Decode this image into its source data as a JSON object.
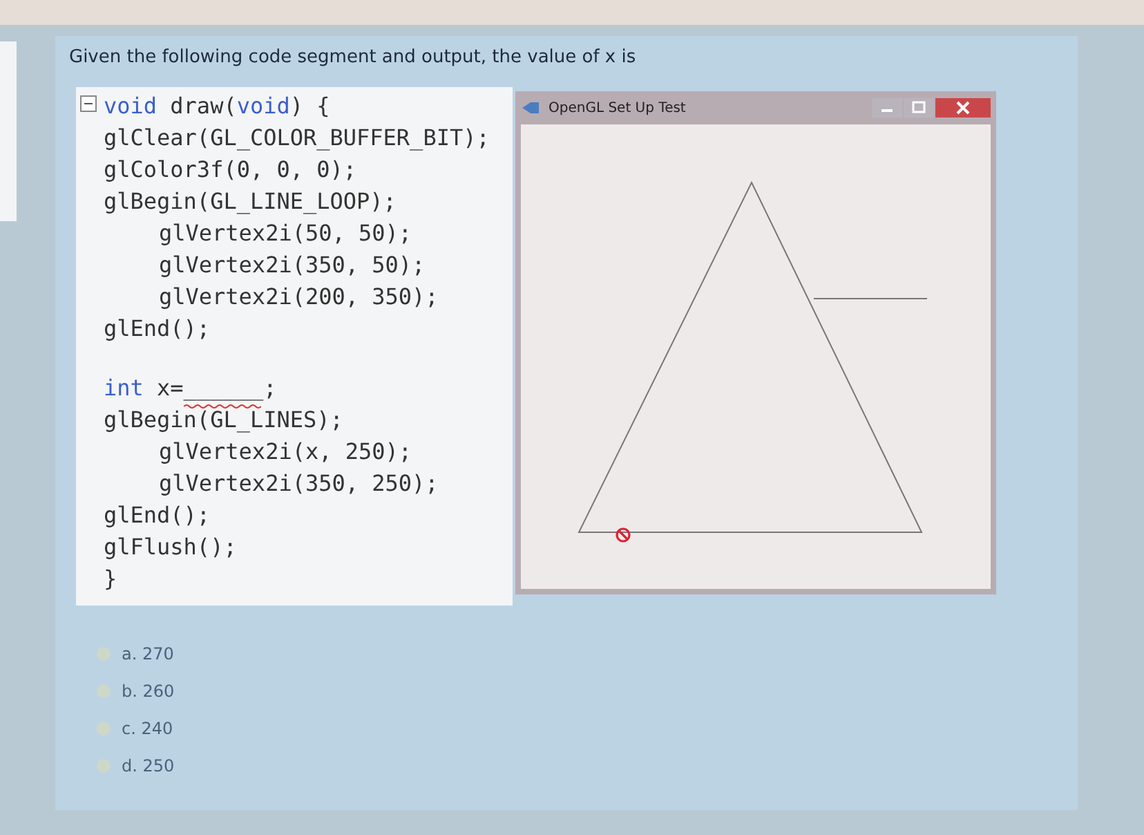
{
  "question": {
    "text": "Given the following code segment and output, the value of x is"
  },
  "code": {
    "blocks": [
      [
        {
          "segments": [
            {
              "kind": "keyword",
              "text": "void"
            },
            {
              "kind": "plain",
              "text": " draw("
            },
            {
              "kind": "keyword",
              "text": "void"
            },
            {
              "kind": "plain",
              "text": ") {"
            }
          ]
        },
        {
          "segments": [
            {
              "kind": "plain",
              "text": "glClear(GL_COLOR_BUFFER_BIT);"
            }
          ]
        },
        {
          "segments": [
            {
              "kind": "plain",
              "text": "glColor3f(0, 0, 0);"
            }
          ]
        },
        {
          "segments": [
            {
              "kind": "plain",
              "text": "glBegin(GL_LINE_LOOP);"
            }
          ],
          "children": [
            {
              "segments": [
                {
                  "kind": "plain",
                  "text": "glVertex2i(50, 50);"
                }
              ]
            },
            {
              "segments": [
                {
                  "kind": "plain",
                  "text": "glVertex2i(350, 50);"
                }
              ]
            },
            {
              "segments": [
                {
                  "kind": "plain",
                  "text": "glVertex2i(200, 350);"
                }
              ]
            }
          ]
        },
        {
          "segments": [
            {
              "kind": "plain",
              "text": "glEnd();"
            }
          ]
        }
      ],
      [
        {
          "segments": [
            {
              "kind": "keyword",
              "text": "int"
            },
            {
              "kind": "plain",
              "text": " x=______;"
            }
          ],
          "error_marked": true
        },
        {
          "segments": [
            {
              "kind": "plain",
              "text": "glBegin(GL_LINES);"
            }
          ],
          "children": [
            {
              "segments": [
                {
                  "kind": "plain",
                  "text": "glVertex2i(x, 250);"
                }
              ]
            },
            {
              "segments": [
                {
                  "kind": "plain",
                  "text": "glVertex2i(350, 250);"
                }
              ]
            }
          ]
        },
        {
          "segments": [
            {
              "kind": "plain",
              "text": "glEnd();"
            }
          ]
        },
        {
          "segments": [
            {
              "kind": "plain",
              "text": "glFlush();"
            }
          ]
        },
        {
          "segments": [
            {
              "kind": "plain",
              "text": "}"
            }
          ]
        }
      ]
    ]
  },
  "output_window": {
    "title": "OpenGL Set Up Test"
  },
  "options": [
    {
      "label": "a. 270",
      "selected": false
    },
    {
      "label": "b. 260",
      "selected": false
    },
    {
      "label": "c. 240",
      "selected": false
    },
    {
      "label": "d. 250",
      "selected": false
    }
  ]
}
